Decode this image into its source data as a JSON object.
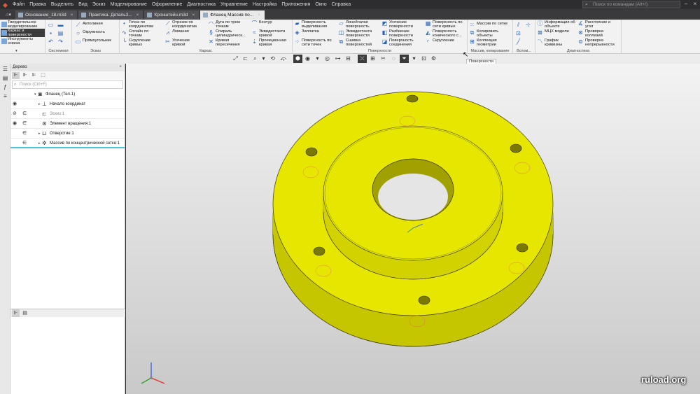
{
  "menu": {
    "items": [
      "Файл",
      "Правка",
      "Выделить",
      "Вид",
      "Эскиз",
      "Моделирование",
      "Оформление",
      "Диагностика",
      "Управление",
      "Настройка",
      "Приложения",
      "Окно",
      "Справка"
    ],
    "search_placeholder": "Поиск по командам (Alt+/)"
  },
  "tabs": [
    {
      "label": "Основание_18.m3d",
      "active": false
    },
    {
      "label": "Практика. Деталь3...",
      "active": false
    },
    {
      "label": "Кронштейн.m3d",
      "active": false
    },
    {
      "label": "Фланец Массив по...",
      "active": true
    }
  ],
  "ribbon": {
    "modes": [
      "Твердотельное\nмоделирование",
      "Каркас и\nповерхности",
      "Инструменты\nэскиза"
    ],
    "system_label": "Системная",
    "sketch": {
      "label": "Эскиз",
      "items": [
        "Автолиния",
        "Окружность",
        "Прямоугольник"
      ]
    },
    "wire": {
      "label": "Каркас",
      "items": [
        "Точка по\nкоординатам",
        "Отрезок по\nкоординатам",
        "Дуга по трем\nточкам",
        "Контур",
        "Сплайн по\nточкам",
        "Ломаная",
        "Спираль\nцилиндрическ...",
        "Эквидистанта\nкривой",
        "Скругление\nкривых",
        "Усечение\nкривой",
        "Кривая\nпересечения",
        "Проекционная\nкривая"
      ]
    },
    "surfaces": {
      "label": "Поверхности",
      "items": [
        "Поверхность\nвыделивания",
        "Линейчатая\nповерхность",
        "Усечение\nповерхности",
        "Поверхность по\nсети кривых",
        "Заплатка",
        "Эквидистанта\nповерхности",
        "Разбиение\nповерхности",
        "Поверхность\nконического с...",
        "Поверхность по\nсети точек",
        "Сшивка\nповерхностей",
        "Поверхность\nсоединения",
        "Скругление"
      ]
    },
    "array": {
      "label": "Массив, копирование",
      "items": [
        "Массив по сетке",
        "Копировать\nобъекты",
        "Коллекция\nгеометрии"
      ]
    },
    "aux_label": "Вспом...",
    "diag": {
      "label": "Диагностика",
      "items": [
        "Информация об\nобъекте",
        "Расстояние и\nугол",
        "МЦХ модели",
        "Проверка\nколлизий",
        "График\nкривизны",
        "Проверка\nнепрерывности"
      ]
    }
  },
  "tooltip": "Поверхности",
  "panel": {
    "title": "Дерево",
    "search_placeholder": "Поиск (Ctrl+F)",
    "tree": [
      {
        "label": "Фланец (Тел-1)",
        "level": 0
      },
      {
        "label": "Начало координат",
        "level": 1
      },
      {
        "label": "Эскиз:1",
        "level": 1
      },
      {
        "label": "Элемент вращения:1",
        "level": 1
      },
      {
        "label": "Отверстие:1",
        "level": 1
      },
      {
        "label": "Массив по концентрической сетке:1",
        "level": 1
      }
    ]
  },
  "watermark": "ruload.org",
  "colors": {
    "part": "#e6e600",
    "part_side": "#c4c400",
    "edge": "#3a3a00",
    "axis_x": "#e03030",
    "axis_y": "#30a030",
    "axis_z": "#3060e0",
    "selection": "#4ec3d8"
  }
}
